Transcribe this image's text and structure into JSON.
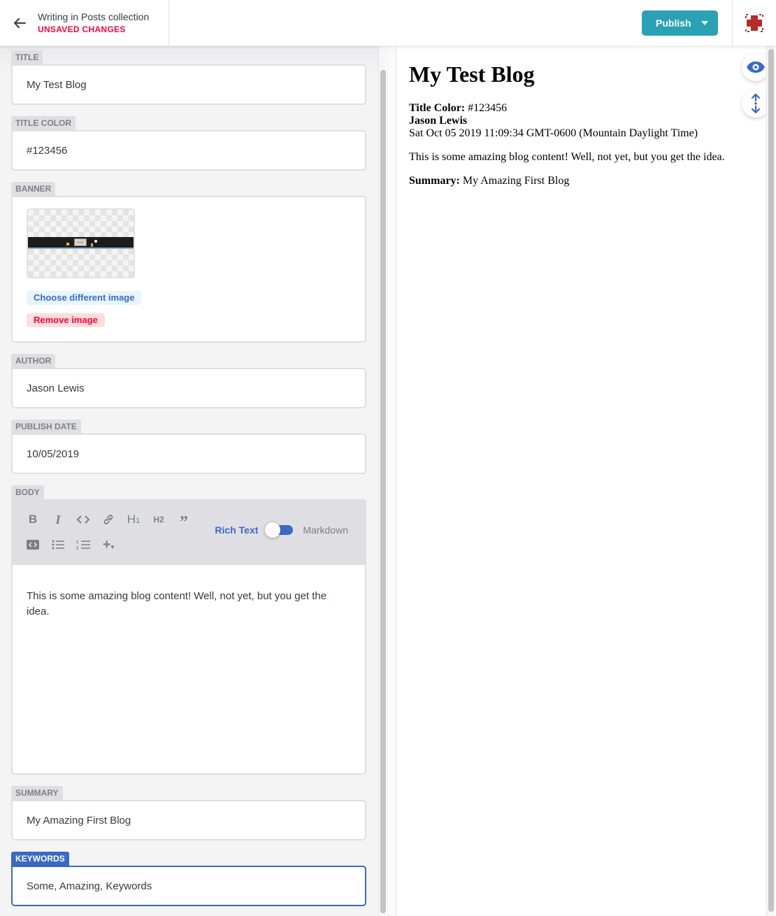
{
  "header": {
    "back_icon": "arrow-left-icon",
    "collection_title": "Writing in Posts collection",
    "status": "UNSAVED CHANGES",
    "publish_label": "Publish",
    "publish_caret_icon": "caret-down-icon",
    "user_icon": "user-avatar-icon"
  },
  "colors": {
    "accent": "#3a69c7",
    "publish": "#2aa2b3",
    "unsaved": "#ff003b"
  },
  "editor": {
    "fields": {
      "title": {
        "label": "TITLE",
        "value": "My Test Blog"
      },
      "title_color": {
        "label": "TITLE COLOR",
        "value": "#123456"
      },
      "banner": {
        "label": "BANNER",
        "choose_label": "Choose different image",
        "remove_label": "Remove image"
      },
      "author": {
        "label": "AUTHOR",
        "value": "Jason Lewis"
      },
      "publish_date": {
        "label": "PUBLISH DATE",
        "value": "10/05/2019"
      },
      "body": {
        "label": "BODY",
        "toolbar": [
          {
            "name": "bold",
            "glyph": "B"
          },
          {
            "name": "italic",
            "glyph": "I"
          },
          {
            "name": "code",
            "glyph": "<>"
          },
          {
            "name": "link",
            "glyph": "link"
          },
          {
            "name": "heading-one",
            "glyph": "H1"
          },
          {
            "name": "heading-two",
            "glyph": "H2"
          },
          {
            "name": "quote",
            "glyph": "quote"
          },
          {
            "name": "code-block",
            "glyph": "code-block"
          },
          {
            "name": "bulleted-list",
            "glyph": "ul"
          },
          {
            "name": "numbered-list",
            "glyph": "ol"
          },
          {
            "name": "add-component",
            "glyph": "+"
          }
        ],
        "mode_rich": "Rich Text",
        "mode_markdown": "Markdown",
        "content": "This is some amazing blog content! Well, not yet, but you get the idea."
      },
      "summary": {
        "label": "SUMMARY",
        "value": "My Amazing First Blog"
      },
      "keywords": {
        "label": "KEYWORDS",
        "value": "Some, Amazing, Keywords"
      }
    }
  },
  "preview": {
    "title": "My Test Blog",
    "title_color_label": "Title Color:",
    "title_color_value": " #123456",
    "author": "Jason Lewis",
    "date": "Sat Oct 05 2019 11:09:34 GMT-0600 (Mountain Daylight Time)",
    "body": "This is some amazing blog content! Well, not yet, but you get the idea.",
    "summary_label": "Summary:",
    "summary_value": " My Amazing First Blog",
    "toggle_preview_icon": "eye-icon",
    "sync_scroll_icon": "sync-scroll-icon"
  }
}
